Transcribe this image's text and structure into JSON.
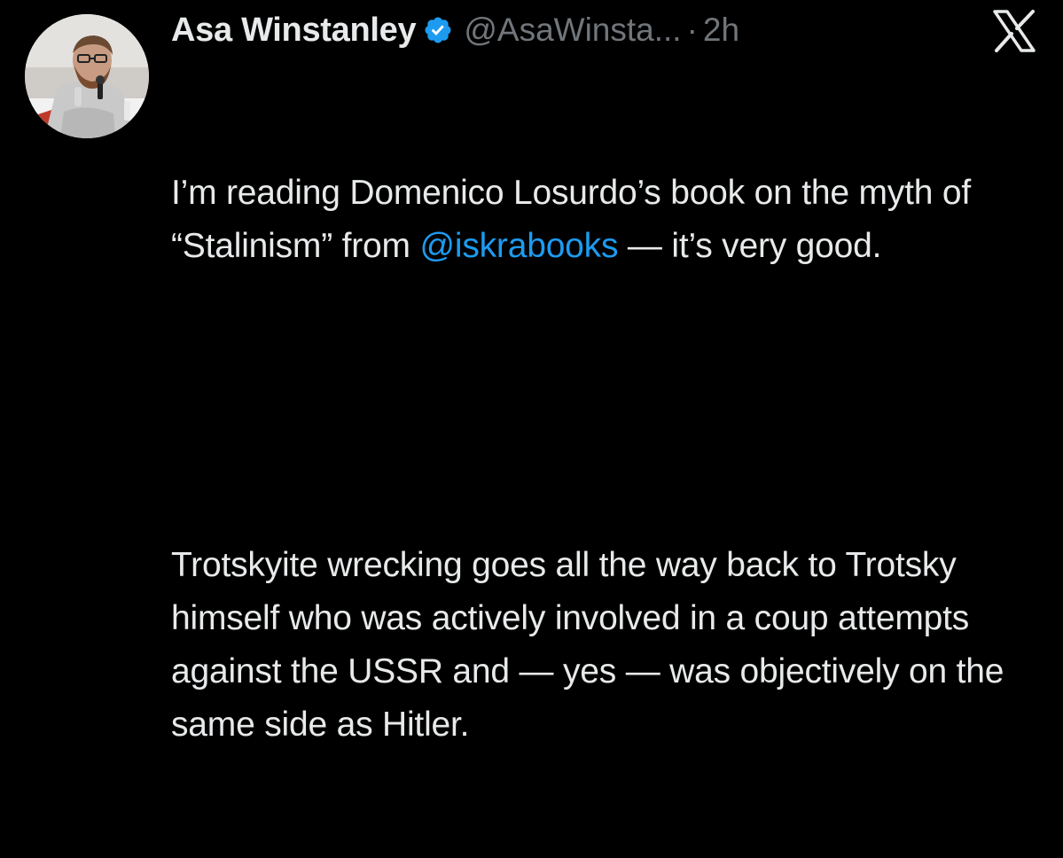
{
  "author": {
    "display_name": "Asa Winstanley",
    "handle": "@AsaWinsta...",
    "separator": "·",
    "timestamp": "2h",
    "verified_icon": "verified-badge-icon",
    "avatar_icon": "profile-avatar"
  },
  "platform": {
    "logo_icon": "x-logo-icon"
  },
  "tweet": {
    "p1_before_mention": "I’m reading Domenico Losurdo’s book on the myth of “Stalinism” from ",
    "mention": "@iskrabooks",
    "p1_after_mention": " — it’s very good.",
    "p2": "Trotskyite wrecking goes all the way back to Trotsky himself who was actively involved in a coup attempts against the USSR and — yes — was objectively on the same side as Hitler."
  },
  "colors": {
    "background": "#000000",
    "text": "#e7e9ea",
    "secondary_text": "#71767b",
    "link": "#1d9bf0",
    "verified": "#1d9bf0"
  }
}
